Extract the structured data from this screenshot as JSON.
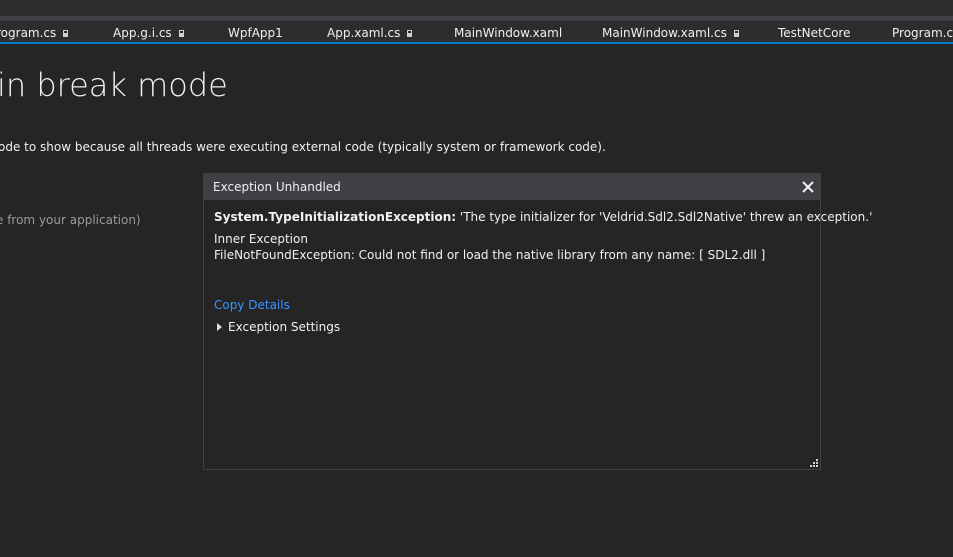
{
  "tabs": [
    {
      "label": "rogram.cs",
      "pinned": true
    },
    {
      "label": "App.g.i.cs",
      "pinned": true
    },
    {
      "label": "WpfApp1",
      "pinned": false
    },
    {
      "label": "App.xaml.cs",
      "pinned": true
    },
    {
      "label": "MainWindow.xaml",
      "pinned": false
    },
    {
      "label": "MainWindow.xaml.cs",
      "pinned": true
    },
    {
      "label": "TestNetCore",
      "pinned": false
    },
    {
      "label": "Program.cs",
      "pinned": false
    }
  ],
  "page": {
    "heading": "in break mode",
    "subtext": "ode to show because all threads were executing external code (typically system or framework code).",
    "faint": "e from your application)"
  },
  "dialog": {
    "title": "Exception Unhandled",
    "exception_type": "System.TypeInitializationException:",
    "exception_message": " 'The type initializer for 'Veldrid.Sdl2.Sdl2Native' threw an exception.'",
    "inner_label": "Inner Exception",
    "inner_message": "FileNotFoundException: Could not find or load the native library from any name: [ SDL2.dll ]",
    "copy_details": "Copy Details",
    "settings_label": "Exception Settings"
  },
  "colors": {
    "background": "#252526",
    "accent": "#007acc",
    "link": "#3794ff",
    "dialog_header": "#3f3f46"
  },
  "icons": [
    "close-icon",
    "expand-triangle-icon",
    "resize-grip-icon",
    "pin-icon"
  ]
}
